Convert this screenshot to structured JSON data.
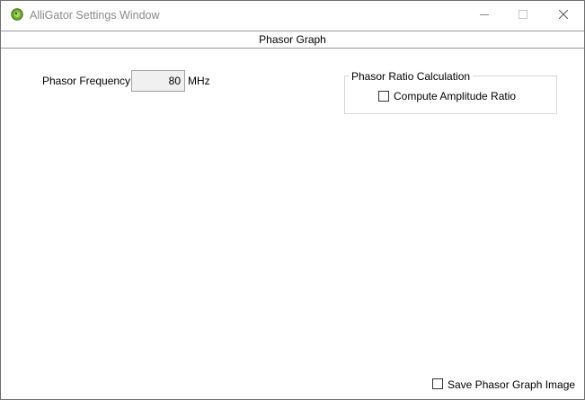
{
  "window": {
    "title": "AlliGator Settings Window",
    "icon": "alligator-app-icon",
    "controls": {
      "minimize_icon": "minimize-icon",
      "maximize_icon": "maximize-icon",
      "close_icon": "close-icon"
    }
  },
  "menu": {
    "items": [
      {
        "label": "Phasor Graph"
      }
    ]
  },
  "phasor_frequency": {
    "label": "Phasor Frequency",
    "value": "80",
    "unit": "MHz"
  },
  "phasor_ratio": {
    "group_label": "Phasor Ratio Calculation",
    "compute_amplitude_ratio": {
      "label": "Compute Amplitude Ratio",
      "checked": false
    }
  },
  "save_image": {
    "label": "Save Phasor Graph Image",
    "checked": false
  },
  "colors": {
    "title_text": "#8a8a8a",
    "border": "#9c9c9c",
    "icon_green": "#6fae2b"
  }
}
